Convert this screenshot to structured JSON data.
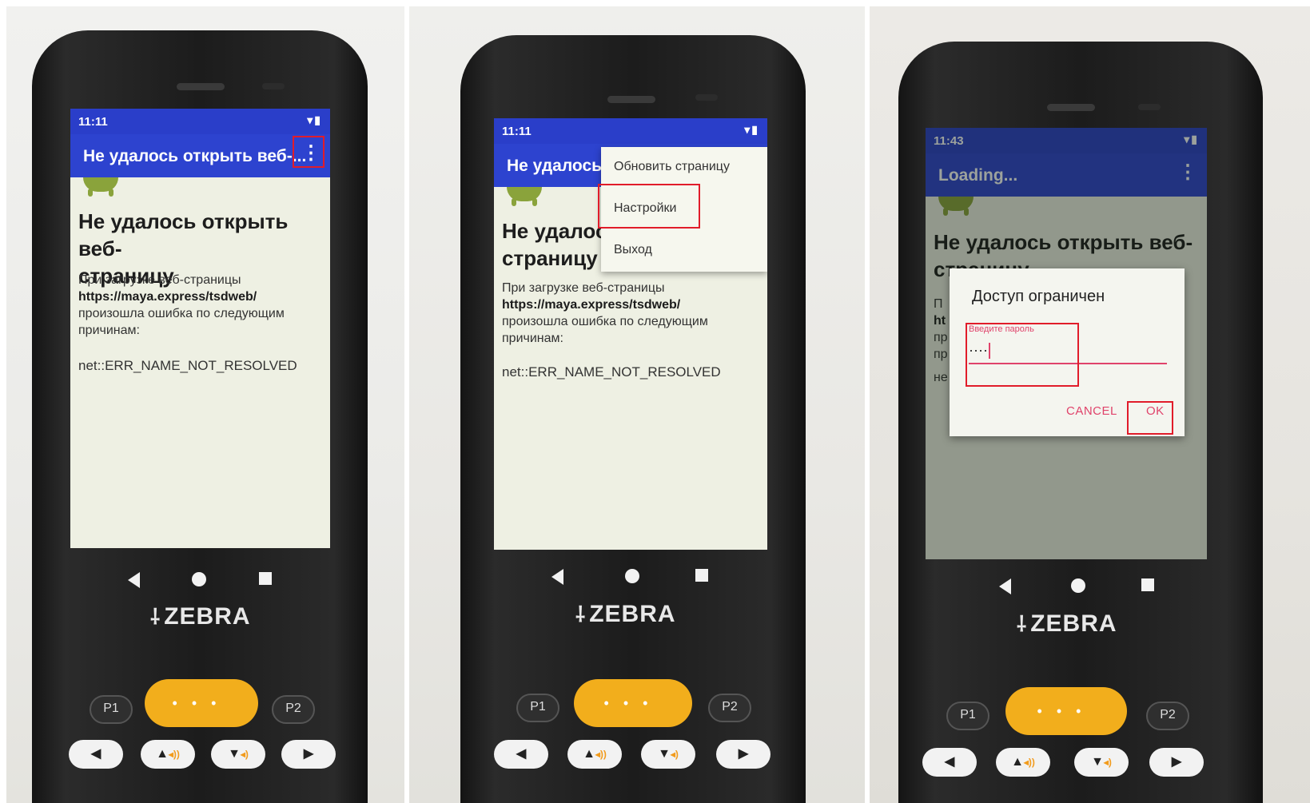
{
  "panels": [
    {
      "statusbar": {
        "time": "11:11",
        "icons": "▾▮"
      },
      "appbar": {
        "title": "Не удалось открыть веб-...",
        "more": "⋮"
      },
      "page": {
        "heading_line1": "Не удалось открыть веб-",
        "heading_line2": "страницу",
        "para_line1": "При загрузке веб-страницы",
        "url": "https://maya.express/tsdweb/",
        "para_line3": "произошла ошибка по следующим",
        "para_line4": "причинам:",
        "error": "net::ERR_NAME_NOT_RESOLVED"
      }
    },
    {
      "statusbar": {
        "time": "11:11",
        "icons": "▾▮"
      },
      "appbar": {
        "title": "Не удалось"
      },
      "page": {
        "heading_line1": "Не удалос",
        "heading_line2": "страницу",
        "para_line1": "При загрузке веб-страницы",
        "url": "https://maya.express/tsdweb/",
        "para_line3": "произошла ошибка по следующим",
        "para_line4": "причинам:",
        "error": "net::ERR_NAME_NOT_RESOLVED"
      },
      "menu": {
        "items": [
          "Обновить страницу",
          "Настройки",
          "Выход"
        ]
      }
    },
    {
      "statusbar": {
        "time": "11:43",
        "icons": "▾▮"
      },
      "appbar": {
        "title": "Loading...",
        "more": "⋮"
      },
      "page": {
        "heading_line1": "Не удалось открыть веб-",
        "heading_line2": "страницу",
        "fragments": [
          "П",
          "ht",
          "пр",
          "пр",
          "не"
        ]
      },
      "dialog": {
        "title": "Доступ ограничен",
        "hint": "Введите пароль",
        "value": "····",
        "cancel": "CANCEL",
        "ok": "OK"
      }
    }
  ],
  "device": {
    "brand": "ZEBRA",
    "brand_mark": "⸸",
    "keys": {
      "p1": "P1",
      "p2": "P2",
      "yellow": "•••",
      "left": "◀",
      "right": "▶",
      "up": "▲",
      "down": "▼",
      "vol_up": "◂))",
      "vol_down": "◂)"
    }
  },
  "colors": {
    "status_bar": "#2a3ec9",
    "app_bar": "#2d43cf",
    "highlight_box": "#e11c2a",
    "accent_pink": "#e0436b",
    "yellow_key": "#f2ae1c"
  }
}
